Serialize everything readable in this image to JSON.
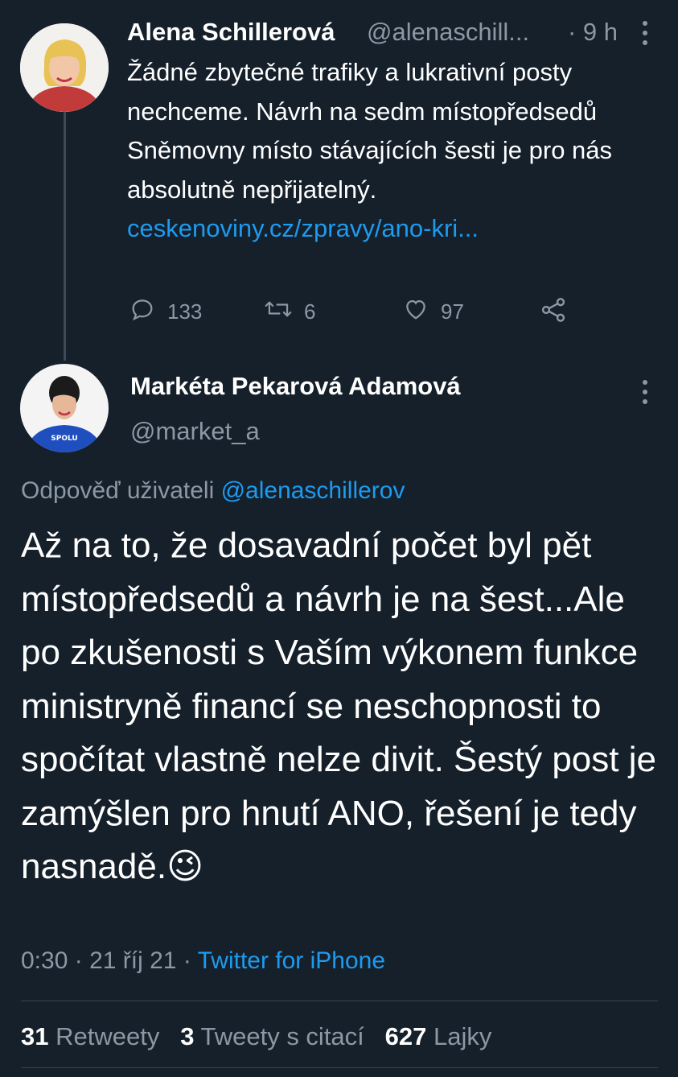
{
  "tweet1": {
    "name": "Alena Schillerová",
    "handle": "@alenaschill...",
    "time": "· 9 h",
    "text": "Žádné zbytečné trafiky a lukrativní posty nechceme. Návrh na sedm místopředsedů Sněmovny místo stávajících šesti je pro nás absolutně nepřijatelný.",
    "link": "ceskenoviny.cz/zpravy/ano-kri...",
    "replies": "133",
    "retweets": "6",
    "likes": "97"
  },
  "tweet2": {
    "name": "Markéta Pekarová Adamová",
    "handle": "@market_a",
    "avatar_badge": "SPOLU",
    "reply_prefix": "Odpověď uživateli",
    "reply_handle": "@alenaschillerov",
    "text": "Až na to, že dosavadní počet byl pět místopředsedů a návrh je na šest...Ale po zkušenosti s Vaším výkonem funkce ministryně financí se neschopnosti to spočítat vlastně nelze divit. Šestý post je zamýšlen pro hnutí ANO, řešení je tedy nasnadě.",
    "emoji": "😉",
    "time": "0:30",
    "date": "21 říj 21",
    "source": "Twitter for iPhone",
    "stats": {
      "retweets_count": "31",
      "retweets_label": "Retweety",
      "quotes_count": "3",
      "quotes_label": "Tweety s citací",
      "likes_count": "627",
      "likes_label": "Lajky"
    }
  },
  "icons": [
    "reply-icon",
    "retweet-icon",
    "like-icon",
    "share-icon",
    "more-icon"
  ],
  "colors": {
    "background": "#15202b",
    "accent": "#1d9bf0",
    "muted": "#8b98a5"
  }
}
